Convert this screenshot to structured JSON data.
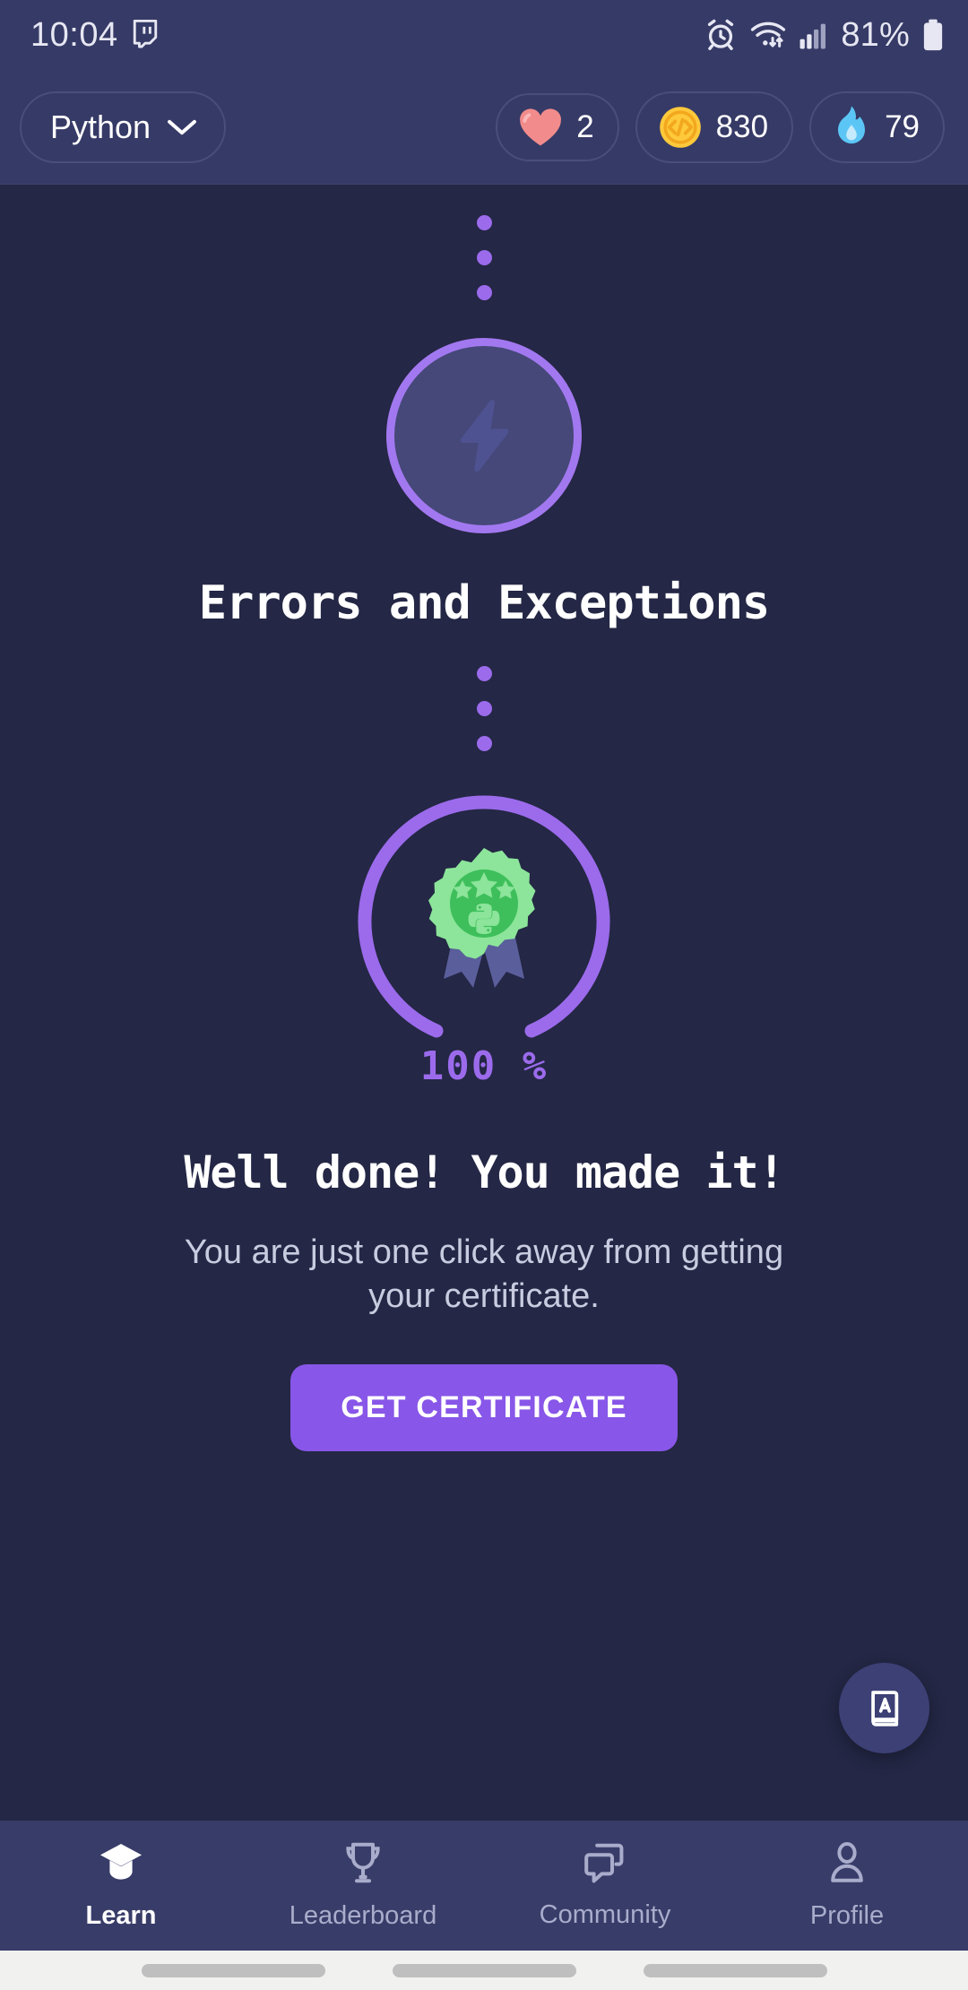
{
  "status_bar": {
    "time": "10:04",
    "app_icon": "twitch-icon",
    "alarm_icon": "alarm-clock-icon",
    "wifi_icon": "wifi-transfer-icon",
    "signal_icon": "cellular-signal-icon",
    "battery_percent": "81%",
    "battery_icon": "battery-icon"
  },
  "header": {
    "language": "Python",
    "language_chevron": "chevron-down-icon",
    "stats": [
      {
        "icon": "heart-icon",
        "value": "2",
        "color": "#F28C8C"
      },
      {
        "icon": "code-coin-icon",
        "value": "830",
        "color": "#FFC93C"
      },
      {
        "icon": "flame-icon",
        "value": "79",
        "color": "#5BC6F5"
      }
    ]
  },
  "main": {
    "lesson_node": {
      "icon": "lightning-bolt-icon",
      "title": "Errors and Exceptions",
      "ring_color": "#A278F0",
      "fill_color": "#454878"
    },
    "certificate": {
      "badge_icon": "python-award-badge-icon",
      "progress_label": "100 %",
      "progress_value": 100,
      "progress_color": "#9B6BEC",
      "badge_color": "#63D173",
      "ribbon_color": "#5A5E9B",
      "headline": "Well done! You made it!",
      "subtitle": "You are just one click away from getting your certificate.",
      "button_label": "GET CERTIFICATE",
      "button_color": "#8856E8"
    },
    "glossary_fab": {
      "icon": "book-a-icon"
    }
  },
  "bottom_nav": {
    "items": [
      {
        "label": "Learn",
        "icon": "graduation-cap-icon",
        "active": true
      },
      {
        "label": "Leaderboard",
        "icon": "trophy-icon",
        "active": false
      },
      {
        "label": "Community",
        "icon": "chat-bubbles-icon",
        "active": false
      },
      {
        "label": "Profile",
        "icon": "person-icon",
        "active": false
      }
    ]
  }
}
